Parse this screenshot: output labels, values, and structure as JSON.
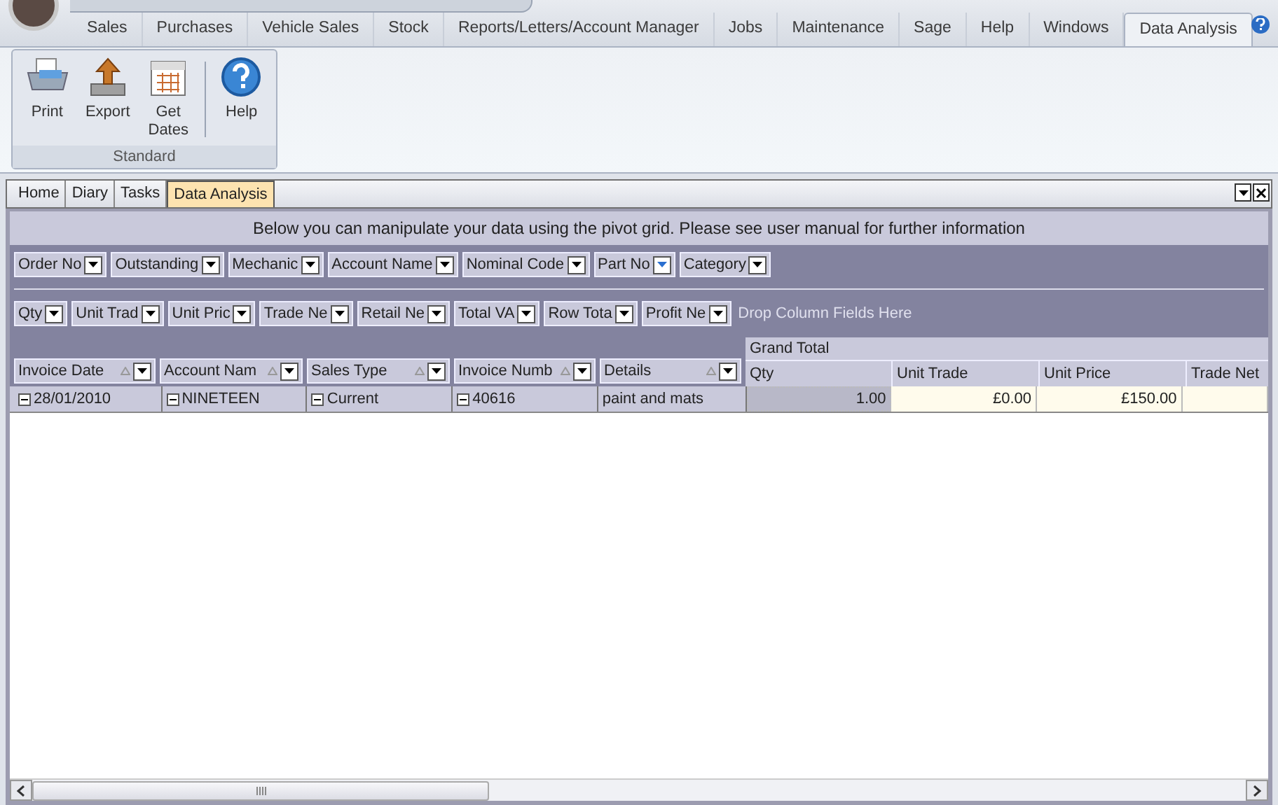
{
  "menu_tabs": [
    {
      "label": "Sales",
      "selected": false
    },
    {
      "label": "Purchases",
      "selected": false
    },
    {
      "label": "Vehicle Sales",
      "selected": false
    },
    {
      "label": "Stock",
      "selected": false
    },
    {
      "label": "Reports/Letters/Account Manager",
      "selected": false
    },
    {
      "label": "Jobs",
      "selected": false
    },
    {
      "label": "Maintenance",
      "selected": false
    },
    {
      "label": "Sage",
      "selected": false
    },
    {
      "label": "Help",
      "selected": false
    },
    {
      "label": "Windows",
      "selected": false
    },
    {
      "label": "Data Analysis",
      "selected": true
    }
  ],
  "ribbon": {
    "group": "Standard",
    "buttons": [
      {
        "kind": "print",
        "label": "Print"
      },
      {
        "kind": "export",
        "label": "Export"
      },
      {
        "kind": "dates",
        "label": "Get Dates"
      },
      {
        "kind": "help",
        "label": "Help"
      }
    ]
  },
  "doc_tabs": [
    {
      "label": "Home",
      "selected": false
    },
    {
      "label": "Diary",
      "selected": false
    },
    {
      "label": "Tasks",
      "selected": false
    },
    {
      "label": "Data Analysis",
      "selected": true
    }
  ],
  "info_text": "Below you can manipulate your data using the pivot grid.  Please see user manual for further information",
  "filter_fields": [
    {
      "label": "Order No",
      "filtered": false
    },
    {
      "label": "Outstanding",
      "filtered": false
    },
    {
      "label": "Mechanic",
      "filtered": false
    },
    {
      "label": "Account Name",
      "filtered": false
    },
    {
      "label": "Nominal Code",
      "filtered": false
    },
    {
      "label": "Part No",
      "filtered": true
    },
    {
      "label": "Category",
      "filtered": false
    }
  ],
  "data_fields": [
    {
      "label": "Qty"
    },
    {
      "label": "Unit Trad"
    },
    {
      "label": "Unit Pric"
    },
    {
      "label": "Trade Ne"
    },
    {
      "label": "Retail Ne"
    },
    {
      "label": "Total VA"
    },
    {
      "label": "Row Tota"
    },
    {
      "label": "Profit Ne"
    }
  ],
  "column_drop_hint": "Drop Column Fields Here",
  "column_header": "Grand Total",
  "row_fields": [
    {
      "label": "Invoice Date"
    },
    {
      "label": "Account Nam"
    },
    {
      "label": "Sales Type"
    },
    {
      "label": "Invoice Numb"
    },
    {
      "label": "Details"
    }
  ],
  "value_columns": [
    "Qty",
    "Unit Trade",
    "Unit Price",
    "Trade Net"
  ],
  "rows": [
    {
      "row_values": [
        {
          "text": "28/01/2010",
          "expandable": true
        },
        {
          "text": "NINETEEN",
          "expandable": true
        },
        {
          "text": "Current",
          "expandable": true
        },
        {
          "text": "40616",
          "expandable": true
        },
        {
          "text": "paint and mats",
          "expandable": false
        }
      ],
      "cells": [
        {
          "text": "1.00",
          "selected": true
        },
        {
          "text": "£0.00",
          "selected": false
        },
        {
          "text": "£150.00",
          "selected": false
        },
        {
          "text": "",
          "selected": false
        }
      ]
    }
  ]
}
